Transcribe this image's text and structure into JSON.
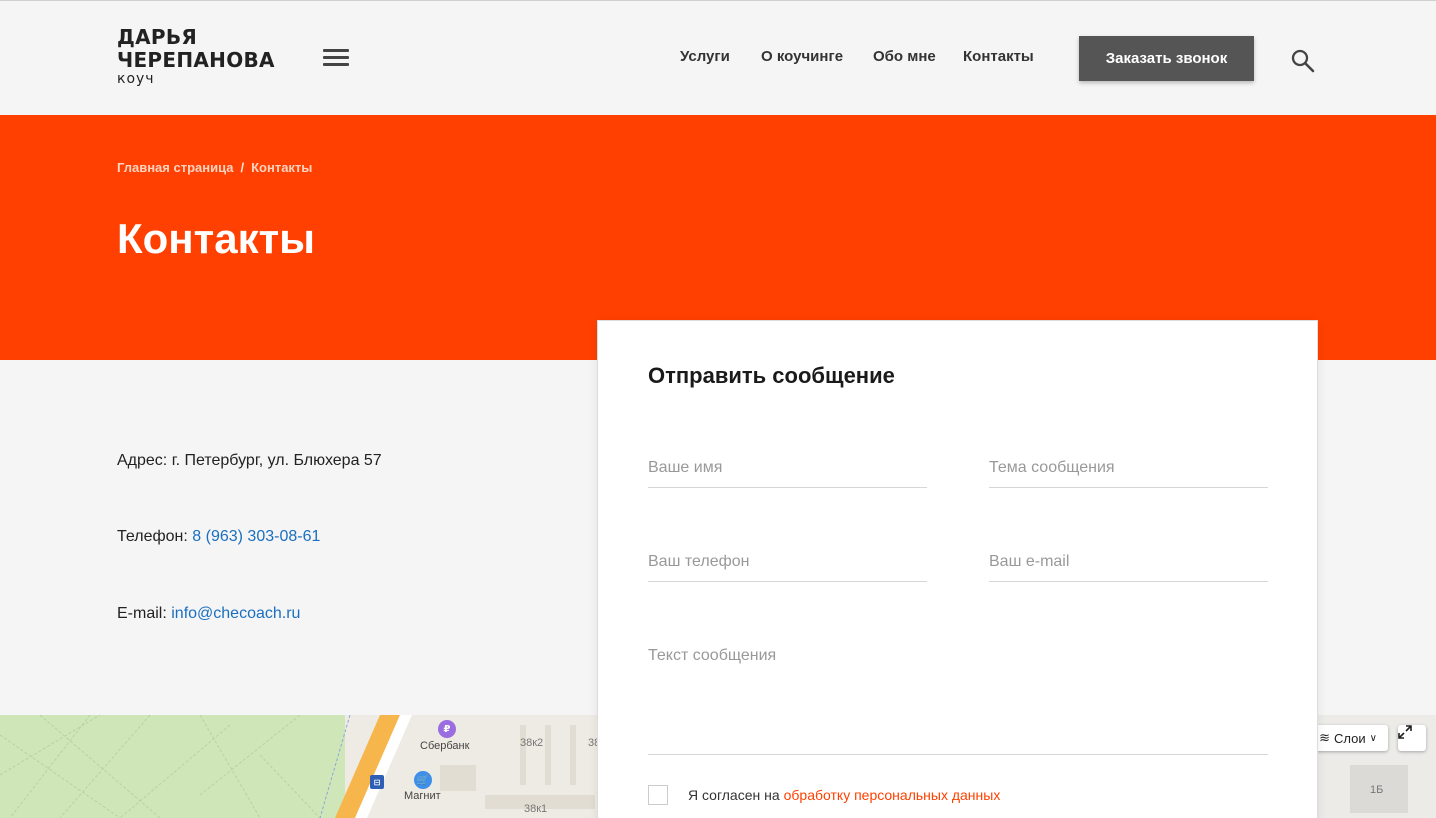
{
  "logo": {
    "line1": "ДАРЬЯ",
    "line2": "ЧЕРЕПАНОВА",
    "line3": "коуч"
  },
  "nav": [
    {
      "label": "Услуги"
    },
    {
      "label": "О коучинге"
    },
    {
      "label": "Обо мне"
    },
    {
      "label": "Контакты"
    }
  ],
  "header": {
    "call_button": "Заказать звонок"
  },
  "breadcrumb": {
    "home": "Главная страница",
    "separator": "/",
    "current": "Контакты"
  },
  "page": {
    "title": "Контакты"
  },
  "contacts": {
    "address_label": "Адрес:",
    "address_value": "г. Петербург, ул. Блюхера 57",
    "phone_label": "Телефон:",
    "phone_value": "8 (963) 303-08-61",
    "email_label": "E-mail:",
    "email_value": "info@checoach.ru"
  },
  "form": {
    "title": "Отправить сообщение",
    "name_placeholder": "Ваше имя",
    "subject_placeholder": "Тема сообщения",
    "phone_placeholder": "Ваш телефон",
    "email_placeholder": "Ваш e-mail",
    "message_placeholder": "Текст сообщения",
    "consent_text": "Я согласен на",
    "consent_link": "обработку персональных данных"
  },
  "map": {
    "labels": {
      "sberbank": "Сбербанк",
      "magnit": "Магнит",
      "b38k2": "38к2",
      "b38a": "38",
      "b38k1": "38к1",
      "b1b": "1Б"
    },
    "layers_button": "Слои"
  },
  "colors": {
    "accent": "#ff4000",
    "link": "#1a6fc0",
    "button": "#555555"
  }
}
